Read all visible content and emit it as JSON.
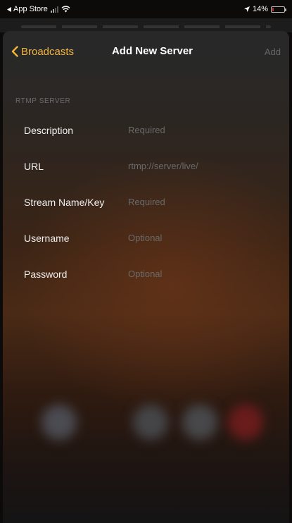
{
  "status_bar": {
    "back_app": "App Store",
    "battery_percent": "14%",
    "battery_level": 0.14,
    "icons": [
      "back-arrow-icon",
      "signal-icon",
      "wifi-icon",
      "location-icon",
      "battery-icon"
    ]
  },
  "nav": {
    "back_label": "Broadcasts",
    "title": "Add New Server",
    "add_label": "Add"
  },
  "section": {
    "header": "RTMP SERVER"
  },
  "fields": [
    {
      "label": "Description",
      "placeholder": "Required"
    },
    {
      "label": "URL",
      "placeholder": "rtmp://server/live/"
    },
    {
      "label": "Stream Name/Key",
      "placeholder": "Required"
    },
    {
      "label": "Username",
      "placeholder": "Optional"
    },
    {
      "label": "Password",
      "placeholder": "Optional"
    }
  ],
  "colors": {
    "accent": "#f2b43b",
    "disabled": "#666666",
    "placeholder": "#6a6a6a"
  }
}
